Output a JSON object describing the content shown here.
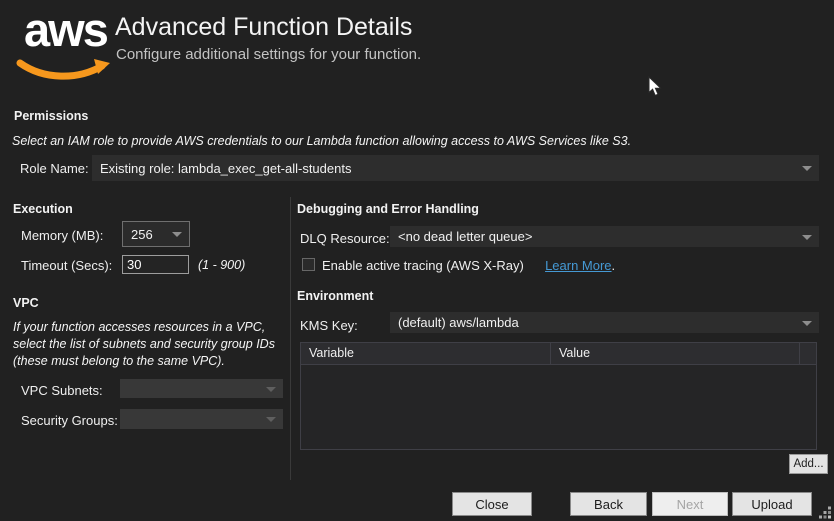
{
  "header": {
    "logo_text": "aws",
    "title": "Advanced Function Details",
    "subtitle": "Configure additional settings for your function."
  },
  "permissions": {
    "heading": "Permissions",
    "description": "Select an IAM role to provide AWS credentials to our Lambda function allowing access to AWS Services like S3.",
    "role_name_label": "Role Name:",
    "role_name_value": "Existing role: lambda_exec_get-all-students"
  },
  "execution": {
    "heading": "Execution",
    "memory_label": "Memory (MB):",
    "memory_value": "256",
    "timeout_label": "Timeout (Secs):",
    "timeout_value": "30",
    "timeout_range": "(1 - 900)"
  },
  "vpc": {
    "heading": "VPC",
    "description": "If your function accesses resources in a VPC, select the list of subnets and security group IDs (these must belong to the same VPC).",
    "subnets_label": "VPC Subnets:",
    "subnets_value": "",
    "security_groups_label": "Security Groups:",
    "security_groups_value": ""
  },
  "debugging": {
    "heading": "Debugging and Error Handling",
    "dlq_label": "DLQ Resource:",
    "dlq_value": "<no dead letter queue>",
    "tracing_label": "Enable active tracing (AWS X-Ray)",
    "tracing_checked": false,
    "learn_more_label": "Learn More",
    "learn_more_suffix": "."
  },
  "environment": {
    "heading": "Environment",
    "kms_label": "KMS Key:",
    "kms_value": "(default) aws/lambda",
    "table": {
      "columns": [
        "Variable",
        "Value"
      ],
      "rows": []
    },
    "add_button_label": "Add..."
  },
  "footer": {
    "close_label": "Close",
    "back_label": "Back",
    "next_label": "Next",
    "upload_label": "Upload"
  },
  "colors": {
    "background": "#212121",
    "accent_orange": "#f7981d",
    "link_blue": "#4599d4",
    "button_face": "#e4e4e4"
  }
}
